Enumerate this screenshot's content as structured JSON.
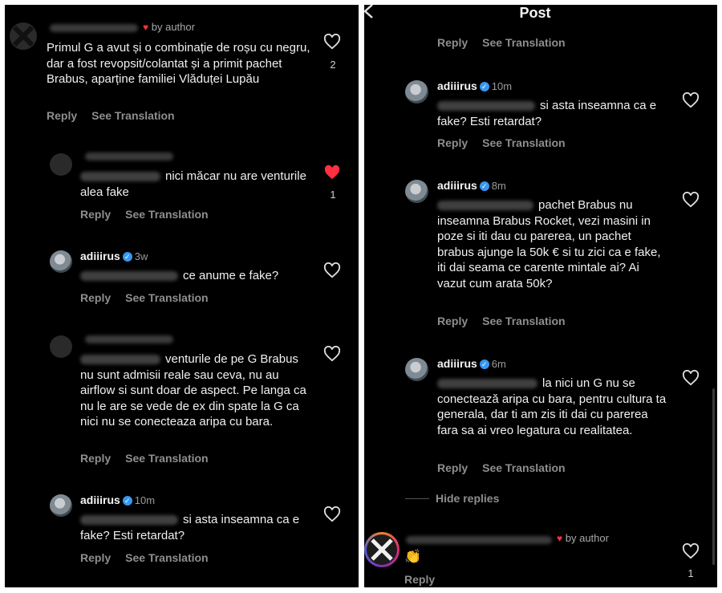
{
  "left": {
    "c0": {
      "by_author": "by author",
      "text": "Primul G a avut și o combinație de roșu cu negru, dar a fost revopsit/colantat și a primit pachet Brabus, aparține familiei Vlăduței Lupău",
      "likes": "2"
    },
    "c1": {
      "text": "nici măcar nu are venturile alea fake",
      "likes": "1"
    },
    "c2": {
      "user": "adiiirus",
      "time": "3w",
      "text": "ce anume e fake?"
    },
    "c3": {
      "text": "venturile de pe G Brabus nu sunt admisii reale sau ceva, nu au airflow si sunt doar de aspect. Pe langa ca nu le are se vede de ex din spate la G ca nici nu se conecteaza aripa cu bara."
    },
    "c4": {
      "user": "adiiirus",
      "time": "10m",
      "text": "si asta inseamna ca e fake? Esti retardat?"
    }
  },
  "right": {
    "title": "Post",
    "c1": {
      "user": "adiiirus",
      "time": "10m",
      "text": "si asta inseamna ca e fake? Esti retardat?"
    },
    "c2": {
      "user": "adiiirus",
      "time": "8m",
      "text": "pachet Brabus nu inseamna Brabus Rocket, vezi masini in poze si iti dau cu parerea, un pachet brabus ajunge la 50k € si tu zici ca e fake, iti dai seama ce carente mintale ai? Ai vazut cum arata 50k?"
    },
    "c3": {
      "user": "adiiirus",
      "time": "6m",
      "text": "la nici un G nu se conectează aripa cu bara, pentru cultura ta generala, dar ti am zis iti dai cu parerea fara sa ai vreo legatura cu realitatea."
    },
    "hide_replies": "Hide replies",
    "c4": {
      "by_author": "by author",
      "text": "👏",
      "likes": "1"
    }
  },
  "actions": {
    "reply": "Reply",
    "see_translation": "See Translation"
  }
}
